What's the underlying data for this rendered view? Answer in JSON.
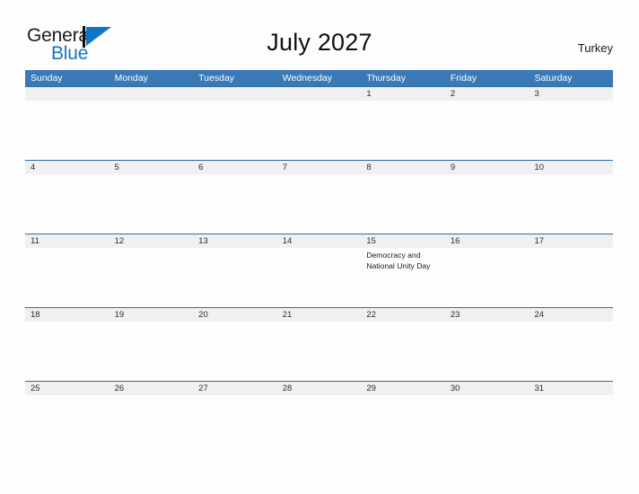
{
  "brand": {
    "name_part1": "General",
    "name_part2": "Blue",
    "flag_icon": "general-blue-flag-logo"
  },
  "header": {
    "title": "July 2027",
    "country": "Turkey"
  },
  "colors": {
    "header_blue": "#3a78b6",
    "week_rule_blue": "#2d6da5",
    "date_band_gray": "#f0f0f0",
    "brand_blue": "#1275c4",
    "page_background": "#fdfdfd",
    "text_dark": "#222222"
  },
  "calendar": {
    "weekday_headers": [
      "Sunday",
      "Monday",
      "Tuesday",
      "Wednesday",
      "Thursday",
      "Friday",
      "Saturday"
    ],
    "weeks": [
      {
        "days": [
          {
            "number": "",
            "event": ""
          },
          {
            "number": "",
            "event": ""
          },
          {
            "number": "",
            "event": ""
          },
          {
            "number": "",
            "event": ""
          },
          {
            "number": "1",
            "event": ""
          },
          {
            "number": "2",
            "event": ""
          },
          {
            "number": "3",
            "event": ""
          }
        ]
      },
      {
        "days": [
          {
            "number": "4",
            "event": ""
          },
          {
            "number": "5",
            "event": ""
          },
          {
            "number": "6",
            "event": ""
          },
          {
            "number": "7",
            "event": ""
          },
          {
            "number": "8",
            "event": ""
          },
          {
            "number": "9",
            "event": ""
          },
          {
            "number": "10",
            "event": ""
          }
        ]
      },
      {
        "days": [
          {
            "number": "11",
            "event": ""
          },
          {
            "number": "12",
            "event": ""
          },
          {
            "number": "13",
            "event": ""
          },
          {
            "number": "14",
            "event": ""
          },
          {
            "number": "15",
            "event": "Democracy and National Unity Day"
          },
          {
            "number": "16",
            "event": ""
          },
          {
            "number": "17",
            "event": ""
          }
        ]
      },
      {
        "days": [
          {
            "number": "18",
            "event": ""
          },
          {
            "number": "19",
            "event": ""
          },
          {
            "number": "20",
            "event": ""
          },
          {
            "number": "21",
            "event": ""
          },
          {
            "number": "22",
            "event": ""
          },
          {
            "number": "23",
            "event": ""
          },
          {
            "number": "24",
            "event": ""
          }
        ]
      },
      {
        "days": [
          {
            "number": "25",
            "event": ""
          },
          {
            "number": "26",
            "event": ""
          },
          {
            "number": "27",
            "event": ""
          },
          {
            "number": "28",
            "event": ""
          },
          {
            "number": "29",
            "event": ""
          },
          {
            "number": "30",
            "event": ""
          },
          {
            "number": "31",
            "event": ""
          }
        ]
      }
    ]
  }
}
